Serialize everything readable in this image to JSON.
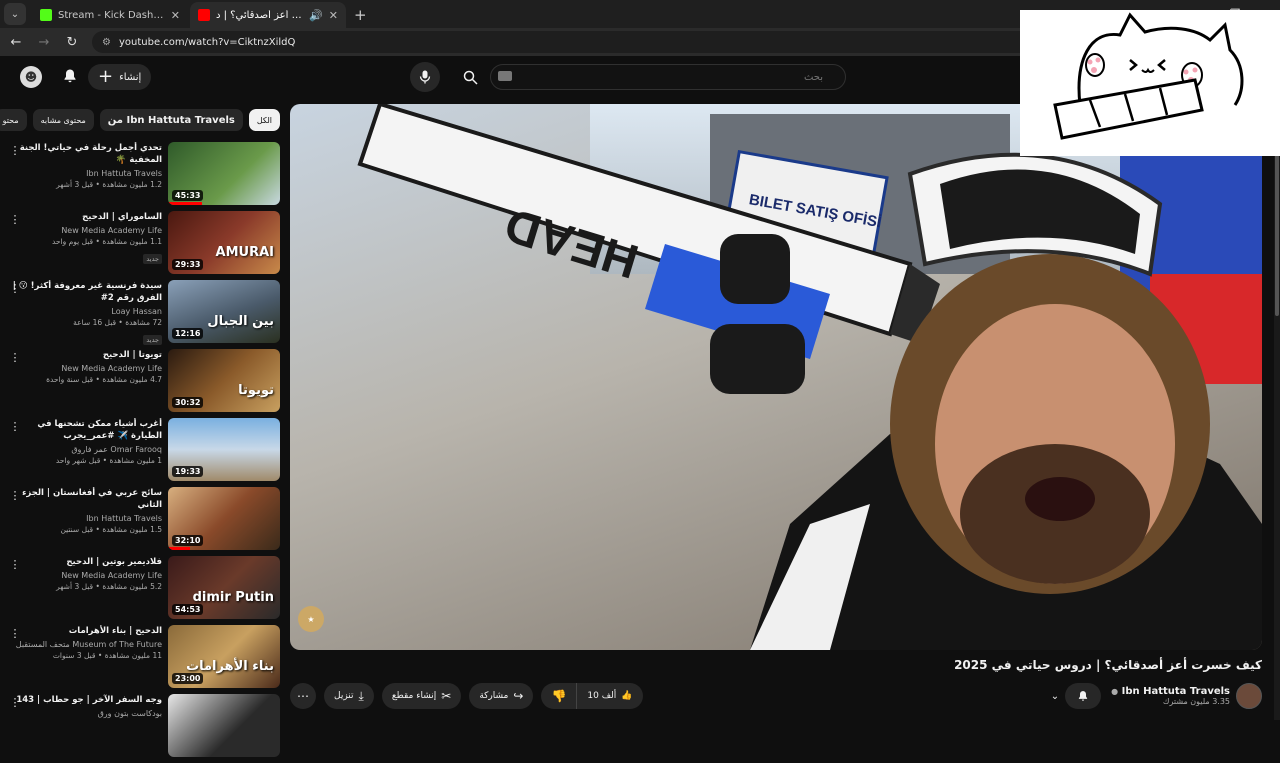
{
  "browser": {
    "tabs": [
      {
        "title": "Stream - Kick Dashboard",
        "favicon_color": "#53fc18",
        "active": false
      },
      {
        "title": "كيف خسرت أعز أصدقائي؟ | د",
        "favicon_color": "#ff0000",
        "active": true
      }
    ],
    "url": "youtube.com/watch?v=CiktnzXildQ"
  },
  "header": {
    "create_label": "إنشاء",
    "search_placeholder": "بحث"
  },
  "chips": [
    "الكل",
    "من Ibn Hattuta Travels",
    "محتوى مشابه",
    "محتو"
  ],
  "recommendations": [
    {
      "title": "تحدي أجمل رحلة في حياتي! الجنة المخفية 🌴",
      "channel": "Ibn Hattuta Travels",
      "stats": "1.2 مليون مشاهدة • قبل 3 أشهر",
      "duration": "45:33",
      "thumb_color": "#4d7a3a",
      "thumb_text": "",
      "progress": 0.3,
      "badge": ""
    },
    {
      "title": "الساموراي | الدحيح",
      "channel": "New Media Academy Life",
      "stats": "1.1 مليون مشاهدة • قبل يوم واحد",
      "duration": "29:33",
      "thumb_color": "#7a2a22",
      "thumb_text": "AMURAI",
      "progress": 0,
      "badge": "جديد"
    },
    {
      "title": "سيدة فرنسية غير معروفة أكثر! 😗 | الفرق رقم 2#",
      "channel": "Loay Hassan",
      "stats": "72 مشاهدة • قبل 16 ساعة",
      "duration": "12:16",
      "thumb_color": "#3a4a5a",
      "thumb_text": "بين الجبال",
      "progress": 0,
      "badge": "جديد"
    },
    {
      "title": "تويوتا | الدحيح",
      "channel": "New Media Academy Life",
      "stats": "4.7 مليون مشاهدة • قبل سنة واحدة",
      "duration": "30:32",
      "thumb_color": "#5a3a2a",
      "thumb_text": "تويوتا",
      "progress": 0,
      "badge": ""
    },
    {
      "title": "أغرب أشياء ممكن تشحنها في الطيارة ✈️ #عمر_يجرب",
      "channel": "Omar Farooq عمر فاروق",
      "stats": "1 مليون مشاهدة • قبل شهر واحد",
      "duration": "19:33",
      "thumb_color": "#3a6a9a",
      "thumb_text": "",
      "progress": 0,
      "badge": ""
    },
    {
      "title": "سائح عربي في أفغانستان | الجزء الثاني",
      "channel": "Ibn Hattuta Travels",
      "stats": "1.5 مليون مشاهدة • قبل سنتين",
      "duration": "32:10",
      "thumb_color": "#8a5a3a",
      "thumb_text": "",
      "progress": 0.2,
      "badge": ""
    },
    {
      "title": "فلاديمير بوتين | الدحيح",
      "channel": "New Media Academy Life",
      "stats": "5.2 مليون مشاهدة • قبل 3 أشهر",
      "duration": "54:53",
      "thumb_color": "#4a2a2a",
      "thumb_text": "dimir Putin",
      "progress": 0,
      "badge": ""
    },
    {
      "title": "الدحيح | بناء الأهرامات",
      "channel": "Museum of The Future متحف المستقبل",
      "stats": "11 مليون مشاهدة • قبل 3 سنوات",
      "duration": "23:00",
      "thumb_color": "#6a4a2a",
      "thumb_text": "بناء الأهرامات",
      "progress": 0,
      "badge": ""
    },
    {
      "title": "وجه السفر الآخر | جو حطاب | 143",
      "channel": "بودكاست بتون ورق",
      "stats": "",
      "duration": "",
      "thumb_color": "#2a2a2a",
      "thumb_text": "",
      "progress": 0,
      "badge": ""
    }
  ],
  "video": {
    "title": "كيف خسرت أعز أصدقائي؟ | دروس حياتي في 2025",
    "channel": "Ibn Hattuta Travels",
    "subscribers": "3.35 مليون مشترك",
    "likes": "10 ألف",
    "share_label": "مشاركة",
    "clip_label": "إنشاء مقطع",
    "download_label": "تنزيل"
  },
  "colors": {
    "background": "#0f0f0f",
    "accent": "#ff0000"
  }
}
